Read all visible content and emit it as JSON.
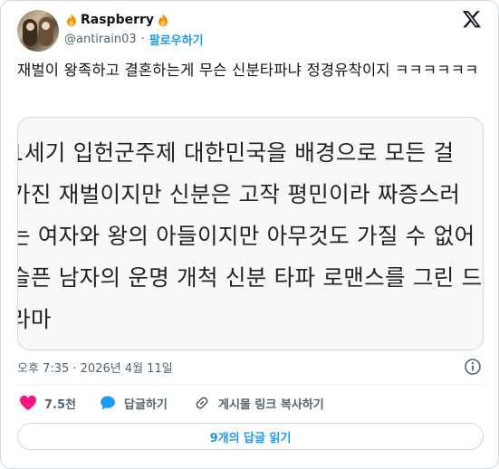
{
  "author": {
    "display_name": "Raspberry",
    "handle": "@antirain03",
    "separator": "·",
    "follow_label": "팔로우하기"
  },
  "tweet": {
    "text": "재벌이 왕족하고 결혼하는게 무슨 신분타파냐 정경유착이지 ㅋㅋㅋㅋㅋㅋ",
    "timestamp": "오후 7:35 · 2026년 4월 11일"
  },
  "media": {
    "lines": [
      "1세기 입헌군주제 대한민국을 배경으로 모든 걸",
      "가진 재벌이지만 신분은 고작 평민이라 짜증스러",
      "는 여자와 왕의 아들이지만 아무것도 가질 수 없어",
      "슬픈 남자의 운명 개척 신분 타파 로맨스를 그린 드",
      "라마"
    ]
  },
  "actions": {
    "like_count": "7.5천",
    "reply_label": "답글하기",
    "copy_link_label": "게시물 링크 복사하기"
  },
  "replies_button": "9개의 답글 읽기",
  "colors": {
    "accent": "#1d9bf0",
    "like": "#f91880",
    "muted": "#536471",
    "text": "#0f1419"
  }
}
